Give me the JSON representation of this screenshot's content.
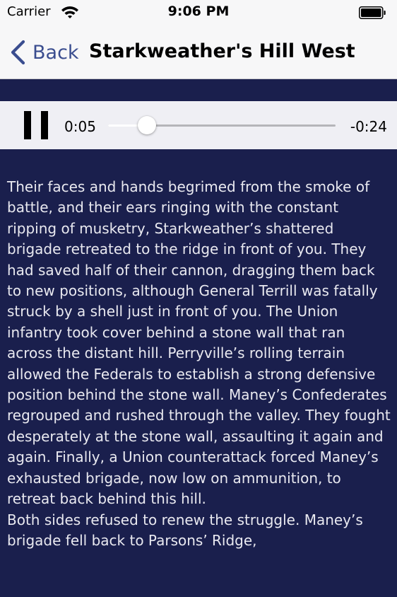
{
  "status_bar": {
    "carrier": "Carrier",
    "time": "9:06 PM"
  },
  "nav": {
    "back_label": "Back",
    "title": "Starkweather's Hill West"
  },
  "player": {
    "elapsed": "0:05",
    "remaining": "-0:24",
    "progress_fraction": 0.17
  },
  "content": {
    "text": "Their faces and hands begrimed from the smoke of battle, and their ears ringing with the constant ripping of musketry, Starkweather’s shattered brigade retreated to the ridge in front of you. They had saved half of their cannon, dragging them back to new positions, although General Terrill was fatally struck by a shell just in front of you. The Union infantry took cover behind a stone wall that ran across the distant hill. Perryville’s rolling terrain allowed the Federals to establish a strong defensive position behind the stone wall. Maney’s Confederates regrouped and rushed through the valley. They fought desperately at the stone wall, assaulting it again and again. Finally, a Union counterattack forced Maney’s exhausted brigade, now low on ammunition, to retreat back behind this hill.\n Both sides refused to renew the struggle. Maney’s brigade fell back to Parsons’ Ridge,"
  },
  "colors": {
    "background": "#1a1f4d",
    "bar_background": "#f7f7f8",
    "accent": "#3a4d8f",
    "body_text": "#e9e9f0"
  }
}
